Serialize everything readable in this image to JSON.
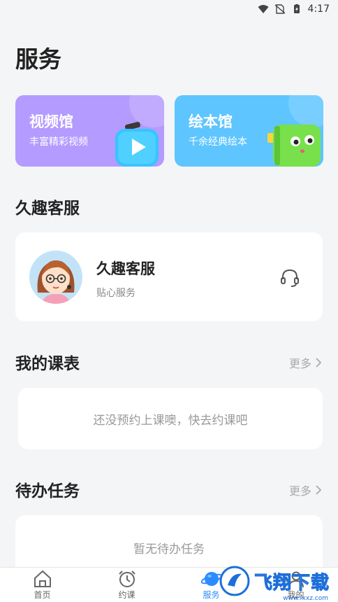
{
  "status_bar": {
    "time": "4:17",
    "icons": [
      "wifi-icon",
      "no-sim-icon",
      "battery-icon"
    ]
  },
  "page_title": "服务",
  "feature_cards": [
    {
      "title": "视频馆",
      "subtitle": "丰富精彩视频",
      "color": "#b49bff",
      "icon": "video-play-icon"
    },
    {
      "title": "绘本馆",
      "subtitle": "千余经典绘本",
      "color": "#5ec5ff",
      "icon": "picture-book-icon"
    }
  ],
  "customer_service": {
    "section_title": "久趣客服",
    "name": "久趣客服",
    "description": "贴心服务",
    "icon": "headset-icon"
  },
  "schedule": {
    "section_title": "我的课表",
    "more_label": "更多",
    "empty_text": "还没预约上课噢，快去约课吧"
  },
  "tasks": {
    "section_title": "待办任务",
    "more_label": "更多",
    "empty_text": "暂无待办任务"
  },
  "tabbar": {
    "active_color": "#2b8cff",
    "items": [
      {
        "label": "首页",
        "icon": "home-icon"
      },
      {
        "label": "约课",
        "icon": "alarm-clock-icon"
      },
      {
        "label": "服务",
        "icon": "planet-icon",
        "active": true
      },
      {
        "label": "我的",
        "icon": "user-icon"
      }
    ]
  },
  "watermark": {
    "text": "飞翔下载",
    "url": "www.fxxz.com"
  }
}
